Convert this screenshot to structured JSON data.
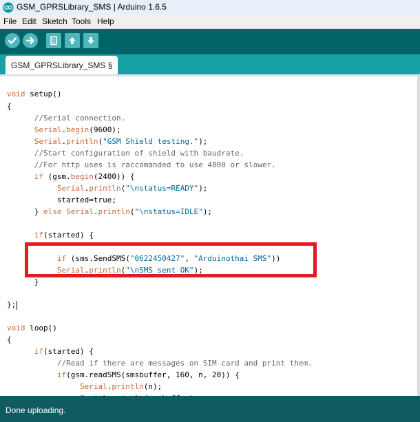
{
  "window": {
    "title": "GSM_GPRSLibrary_SMS | Arduino 1.6.5"
  },
  "menu": {
    "items": [
      "File",
      "Edit",
      "Sketch",
      "Tools",
      "Help"
    ]
  },
  "toolbar": {
    "buttons": [
      "verify-icon",
      "upload-icon",
      "new-icon",
      "open-icon",
      "save-icon"
    ]
  },
  "tabs": [
    {
      "label": "GSM_GPRSLibrary_SMS §"
    }
  ],
  "editor": {
    "lines": [
      [
        [
          "kw",
          "void"
        ],
        [
          "n",
          " setup()"
        ]
      ],
      [
        [
          "n",
          "{"
        ]
      ],
      [
        [
          "n",
          "      "
        ],
        [
          "cm",
          "//Serial connection."
        ]
      ],
      [
        [
          "n",
          "      "
        ],
        [
          "kw",
          "Serial"
        ],
        [
          "n",
          "."
        ],
        [
          "kw",
          "begin"
        ],
        [
          "n",
          "(9600);"
        ]
      ],
      [
        [
          "n",
          "      "
        ],
        [
          "kw",
          "Serial"
        ],
        [
          "n",
          "."
        ],
        [
          "kw",
          "println"
        ],
        [
          "n",
          "("
        ],
        [
          "str",
          "\"GSM Shield testing.\""
        ],
        [
          "n",
          ");"
        ]
      ],
      [
        [
          "n",
          "      "
        ],
        [
          "cm",
          "//Start configuration of shield with baudrate."
        ]
      ],
      [
        [
          "n",
          "      "
        ],
        [
          "cm",
          "//For http uses is raccomanded to use 4800 or slower."
        ]
      ],
      [
        [
          "n",
          "      "
        ],
        [
          "kw",
          "if"
        ],
        [
          "n",
          " (gsm."
        ],
        [
          "kw",
          "begin"
        ],
        [
          "n",
          "(2400)) {"
        ]
      ],
      [
        [
          "n",
          "           "
        ],
        [
          "kw",
          "Serial"
        ],
        [
          "n",
          "."
        ],
        [
          "kw",
          "println"
        ],
        [
          "n",
          "("
        ],
        [
          "str",
          "\"\\nstatus=READY\""
        ],
        [
          "n",
          ");"
        ]
      ],
      [
        [
          "n",
          "           started=true;"
        ]
      ],
      [
        [
          "n",
          "      } "
        ],
        [
          "kw",
          "else"
        ],
        [
          "n",
          " "
        ],
        [
          "kw",
          "Serial"
        ],
        [
          "n",
          "."
        ],
        [
          "kw",
          "println"
        ],
        [
          "n",
          "("
        ],
        [
          "str",
          "\"\\nstatus=IDLE\""
        ],
        [
          "n",
          ");"
        ]
      ],
      [
        [
          "n",
          ""
        ]
      ],
      [
        [
          "n",
          "      "
        ],
        [
          "kw",
          "if"
        ],
        [
          "n",
          "(started) {"
        ]
      ],
      [
        [
          "n",
          ""
        ]
      ],
      [
        [
          "n",
          "           "
        ],
        [
          "kw",
          "if"
        ],
        [
          "n",
          " (sms.SendSMS("
        ],
        [
          "str",
          "\"0622450427\""
        ],
        [
          "n",
          ", "
        ],
        [
          "str",
          "\"Arduinothai SMS\""
        ],
        [
          "n",
          "))"
        ]
      ],
      [
        [
          "n",
          "           "
        ],
        [
          "kw",
          "Serial"
        ],
        [
          "n",
          "."
        ],
        [
          "kw",
          "println"
        ],
        [
          "n",
          "("
        ],
        [
          "str",
          "\"\\nSMS sent OK\""
        ],
        [
          "n",
          ");"
        ]
      ],
      [
        [
          "n",
          "      }"
        ]
      ],
      [
        [
          "n",
          ""
        ]
      ],
      [
        [
          "n",
          "};"
        ]
      ],
      [
        [
          "n",
          ""
        ]
      ],
      [
        [
          "kw",
          "void"
        ],
        [
          "n",
          " loop()"
        ]
      ],
      [
        [
          "n",
          "{"
        ]
      ],
      [
        [
          "n",
          "      "
        ],
        [
          "kw",
          "if"
        ],
        [
          "n",
          "(started) {"
        ]
      ],
      [
        [
          "n",
          "           "
        ],
        [
          "cm",
          "//Read if there are messages on SIM card and print them."
        ]
      ],
      [
        [
          "n",
          "           "
        ],
        [
          "kw",
          "if"
        ],
        [
          "n",
          "(gsm.readSMS(smsbuffer, 160, n, 20)) {"
        ]
      ],
      [
        [
          "n",
          "                "
        ],
        [
          "kw",
          "Serial"
        ],
        [
          "n",
          "."
        ],
        [
          "kw",
          "println"
        ],
        [
          "n",
          "(n);"
        ]
      ],
      [
        [
          "n",
          "                "
        ],
        [
          "kw",
          "Serial"
        ],
        [
          "n",
          "."
        ],
        [
          "kw",
          "println"
        ],
        [
          "n",
          "(smsbuffer);"
        ]
      ]
    ]
  },
  "status": {
    "message": "Done uploading."
  }
}
